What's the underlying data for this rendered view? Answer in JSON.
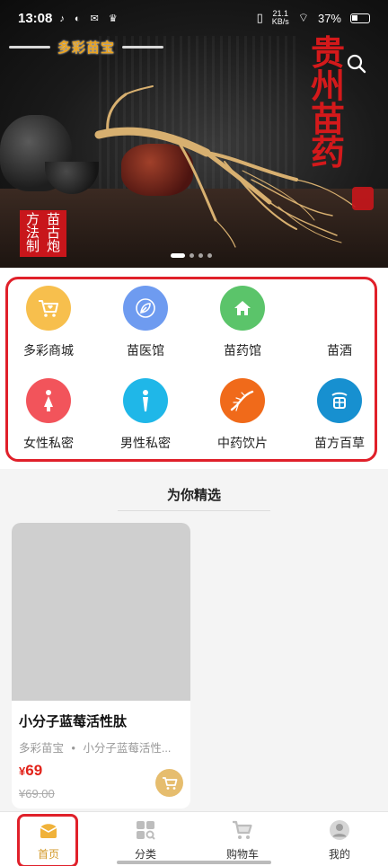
{
  "status_bar": {
    "time": "13:08",
    "net_speed_top": "21.1",
    "net_speed_bottom": "KB/s",
    "battery": "37%"
  },
  "banner": {
    "brand": "多彩苗宝",
    "vertical_title": [
      "贵",
      "州",
      "苗",
      "药"
    ],
    "seal_text": [
      "苗古炮",
      "方法制"
    ],
    "seal_chars": [
      "方",
      "苗",
      "法",
      "古",
      "制",
      "炮"
    ],
    "slide_count": 4,
    "active_slide": 0
  },
  "categories": [
    {
      "label": "多彩商城",
      "color": "#f7bf4d",
      "icon": "shopping-cart-heart-icon"
    },
    {
      "label": "苗医馆",
      "color": "#6e9bf0",
      "icon": "leaf-icon"
    },
    {
      "label": "苗药馆",
      "color": "#5bc46a",
      "icon": "house-icon"
    },
    {
      "label": "苗酒",
      "color": "#ffffff",
      "icon": ""
    },
    {
      "label": "女性私密",
      "color": "#f2545b",
      "icon": "female-figure-icon"
    },
    {
      "label": "男性私密",
      "color": "#1fb7e8",
      "icon": "male-figure-icon"
    },
    {
      "label": "中药饮片",
      "color": "#f06a1a",
      "icon": "herb-root-icon"
    },
    {
      "label": "苗方百草",
      "color": "#1790d0",
      "icon": "miao-emblem-icon"
    }
  ],
  "section": {
    "title": "为你精选"
  },
  "product": {
    "title": "小分子蓝莓活性肽",
    "shop": "多彩苗宝",
    "separator": "•",
    "subtitle": "小分子蓝莓活性...",
    "currency": "¥",
    "price": "69",
    "original_price": "¥69.00"
  },
  "tabs": [
    {
      "label": "首页",
      "icon": "home-box-icon",
      "active": true
    },
    {
      "label": "分类",
      "icon": "category-grid-icon",
      "active": false
    },
    {
      "label": "购物车",
      "icon": "cart-icon",
      "active": false
    },
    {
      "label": "我的",
      "icon": "profile-icon",
      "active": false
    }
  ],
  "colors": {
    "accent": "#d39a2b",
    "price": "#e2231a",
    "highlight_frame": "#e0202a"
  }
}
